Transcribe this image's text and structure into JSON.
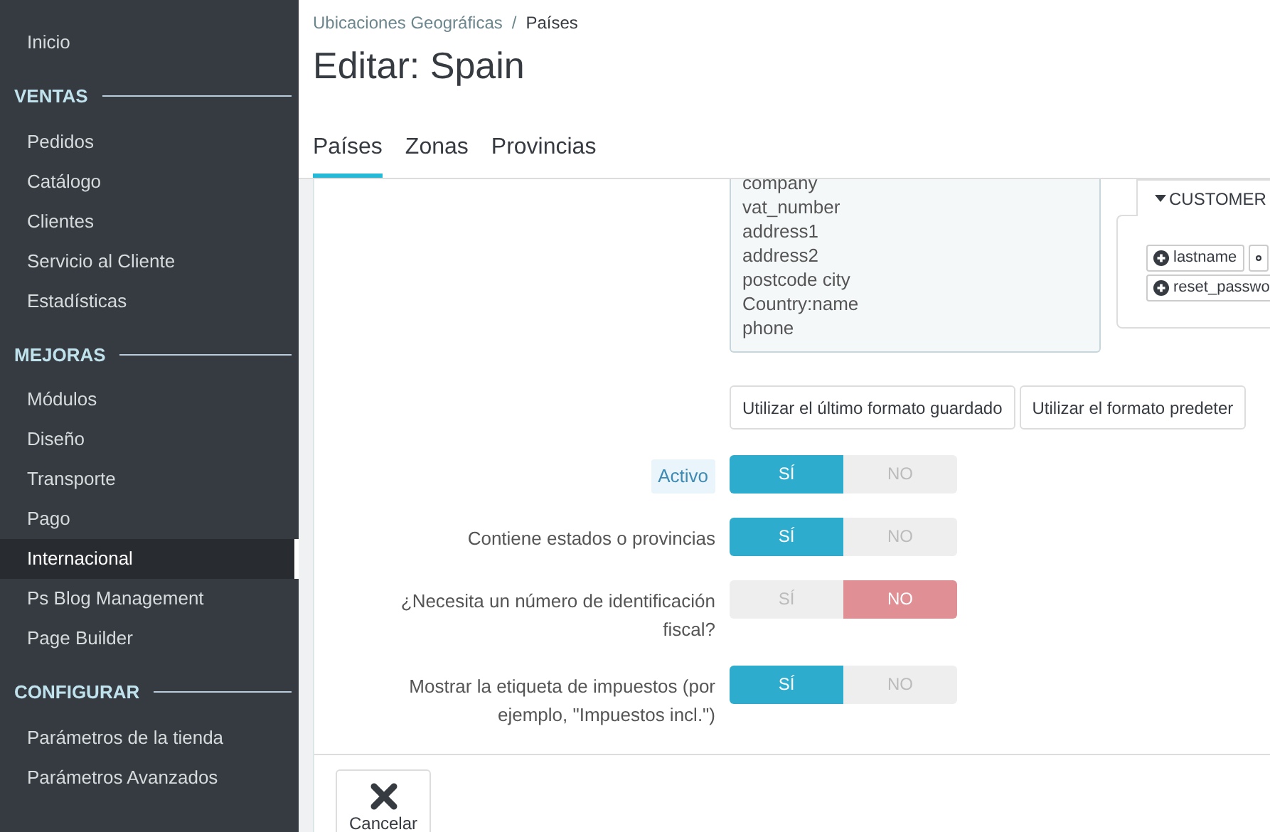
{
  "sidebar": {
    "items": [
      {
        "kind": "item",
        "label": "Inicio",
        "selected": false
      },
      {
        "kind": "section",
        "label": "VENTAS"
      },
      {
        "kind": "item",
        "label": "Pedidos",
        "selected": false
      },
      {
        "kind": "item",
        "label": "Catálogo",
        "selected": false
      },
      {
        "kind": "item",
        "label": "Clientes",
        "selected": false
      },
      {
        "kind": "item",
        "label": "Servicio al Cliente",
        "selected": false
      },
      {
        "kind": "item",
        "label": "Estadísticas",
        "selected": false
      },
      {
        "kind": "section",
        "label": "MEJORAS"
      },
      {
        "kind": "item",
        "label": "Módulos",
        "selected": false
      },
      {
        "kind": "item",
        "label": "Diseño",
        "selected": false
      },
      {
        "kind": "item",
        "label": "Transporte",
        "selected": false
      },
      {
        "kind": "item",
        "label": "Pago",
        "selected": false
      },
      {
        "kind": "item",
        "label": "Internacional",
        "selected": true
      },
      {
        "kind": "item",
        "label": "Ps Blog Management",
        "selected": false
      },
      {
        "kind": "item",
        "label": "Page Builder",
        "selected": false
      },
      {
        "kind": "section",
        "label": "CONFIGURAR"
      },
      {
        "kind": "item",
        "label": "Parámetros de la tienda",
        "selected": false
      },
      {
        "kind": "item",
        "label": "Parámetros Avanzados",
        "selected": false
      }
    ]
  },
  "breadcrumb": [
    "Ubicaciones Geográficas",
    "/",
    "Países"
  ],
  "title": "Editar: Spain",
  "tabs": [
    {
      "label": "Países",
      "selected": true
    },
    {
      "label": "Zonas",
      "selected": false
    },
    {
      "label": "Provincias",
      "selected": false
    }
  ],
  "address_format": {
    "lines": [
      "company",
      "vat_number",
      "address1",
      "address2",
      "postcode city",
      "Country:name",
      "phone"
    ]
  },
  "field_panel": {
    "tabs": [
      {
        "label": "CUSTOMER",
        "expanded": true
      }
    ],
    "fields": [
      {
        "kind": "field",
        "label": "lastname"
      },
      {
        "kind": "clipped"
      },
      {
        "kind": "field",
        "label": "reset_passwo"
      }
    ]
  },
  "format_buttons": [
    "Utilizar el último formato guardado",
    "Utilizar el formato predeter"
  ],
  "switches": [
    {
      "label": "Activo",
      "highlighted": true,
      "on": true,
      "yes": "SÍ",
      "no": "NO"
    },
    {
      "label": "Contiene estados o provincias",
      "highlighted": false,
      "on": true,
      "yes": "SÍ",
      "no": "NO"
    },
    {
      "label": "¿Necesita un número de identificación fiscal?",
      "highlighted": false,
      "on": false,
      "yes": "SÍ",
      "no": "NO"
    },
    {
      "label": "Mostrar la etiqueta de impuestos (por ejemplo, \"Impuestos incl.\")",
      "highlighted": false,
      "on": true,
      "yes": "SÍ",
      "no": "NO"
    }
  ],
  "footer": {
    "cancel": "Cancelar"
  }
}
